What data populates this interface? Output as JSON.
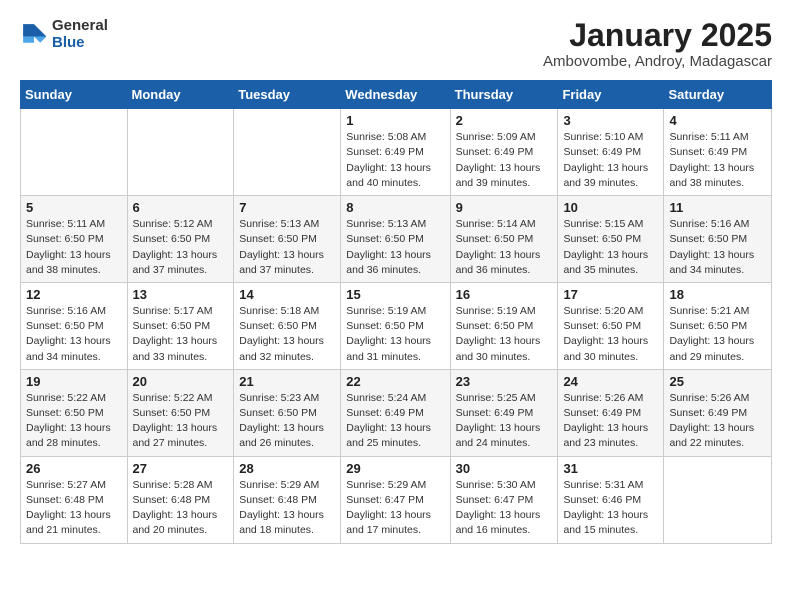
{
  "logo": {
    "general": "General",
    "blue": "Blue"
  },
  "header": {
    "title": "January 2025",
    "subtitle": "Ambovombe, Androy, Madagascar"
  },
  "weekdays": [
    "Sunday",
    "Monday",
    "Tuesday",
    "Wednesday",
    "Thursday",
    "Friday",
    "Saturday"
  ],
  "weeks": [
    [
      {
        "day": "",
        "detail": ""
      },
      {
        "day": "",
        "detail": ""
      },
      {
        "day": "",
        "detail": ""
      },
      {
        "day": "1",
        "detail": "Sunrise: 5:08 AM\nSunset: 6:49 PM\nDaylight: 13 hours\nand 40 minutes."
      },
      {
        "day": "2",
        "detail": "Sunrise: 5:09 AM\nSunset: 6:49 PM\nDaylight: 13 hours\nand 39 minutes."
      },
      {
        "day": "3",
        "detail": "Sunrise: 5:10 AM\nSunset: 6:49 PM\nDaylight: 13 hours\nand 39 minutes."
      },
      {
        "day": "4",
        "detail": "Sunrise: 5:11 AM\nSunset: 6:49 PM\nDaylight: 13 hours\nand 38 minutes."
      }
    ],
    [
      {
        "day": "5",
        "detail": "Sunrise: 5:11 AM\nSunset: 6:50 PM\nDaylight: 13 hours\nand 38 minutes."
      },
      {
        "day": "6",
        "detail": "Sunrise: 5:12 AM\nSunset: 6:50 PM\nDaylight: 13 hours\nand 37 minutes."
      },
      {
        "day": "7",
        "detail": "Sunrise: 5:13 AM\nSunset: 6:50 PM\nDaylight: 13 hours\nand 37 minutes."
      },
      {
        "day": "8",
        "detail": "Sunrise: 5:13 AM\nSunset: 6:50 PM\nDaylight: 13 hours\nand 36 minutes."
      },
      {
        "day": "9",
        "detail": "Sunrise: 5:14 AM\nSunset: 6:50 PM\nDaylight: 13 hours\nand 36 minutes."
      },
      {
        "day": "10",
        "detail": "Sunrise: 5:15 AM\nSunset: 6:50 PM\nDaylight: 13 hours\nand 35 minutes."
      },
      {
        "day": "11",
        "detail": "Sunrise: 5:16 AM\nSunset: 6:50 PM\nDaylight: 13 hours\nand 34 minutes."
      }
    ],
    [
      {
        "day": "12",
        "detail": "Sunrise: 5:16 AM\nSunset: 6:50 PM\nDaylight: 13 hours\nand 34 minutes."
      },
      {
        "day": "13",
        "detail": "Sunrise: 5:17 AM\nSunset: 6:50 PM\nDaylight: 13 hours\nand 33 minutes."
      },
      {
        "day": "14",
        "detail": "Sunrise: 5:18 AM\nSunset: 6:50 PM\nDaylight: 13 hours\nand 32 minutes."
      },
      {
        "day": "15",
        "detail": "Sunrise: 5:19 AM\nSunset: 6:50 PM\nDaylight: 13 hours\nand 31 minutes."
      },
      {
        "day": "16",
        "detail": "Sunrise: 5:19 AM\nSunset: 6:50 PM\nDaylight: 13 hours\nand 30 minutes."
      },
      {
        "day": "17",
        "detail": "Sunrise: 5:20 AM\nSunset: 6:50 PM\nDaylight: 13 hours\nand 30 minutes."
      },
      {
        "day": "18",
        "detail": "Sunrise: 5:21 AM\nSunset: 6:50 PM\nDaylight: 13 hours\nand 29 minutes."
      }
    ],
    [
      {
        "day": "19",
        "detail": "Sunrise: 5:22 AM\nSunset: 6:50 PM\nDaylight: 13 hours\nand 28 minutes."
      },
      {
        "day": "20",
        "detail": "Sunrise: 5:22 AM\nSunset: 6:50 PM\nDaylight: 13 hours\nand 27 minutes."
      },
      {
        "day": "21",
        "detail": "Sunrise: 5:23 AM\nSunset: 6:50 PM\nDaylight: 13 hours\nand 26 minutes."
      },
      {
        "day": "22",
        "detail": "Sunrise: 5:24 AM\nSunset: 6:49 PM\nDaylight: 13 hours\nand 25 minutes."
      },
      {
        "day": "23",
        "detail": "Sunrise: 5:25 AM\nSunset: 6:49 PM\nDaylight: 13 hours\nand 24 minutes."
      },
      {
        "day": "24",
        "detail": "Sunrise: 5:26 AM\nSunset: 6:49 PM\nDaylight: 13 hours\nand 23 minutes."
      },
      {
        "day": "25",
        "detail": "Sunrise: 5:26 AM\nSunset: 6:49 PM\nDaylight: 13 hours\nand 22 minutes."
      }
    ],
    [
      {
        "day": "26",
        "detail": "Sunrise: 5:27 AM\nSunset: 6:48 PM\nDaylight: 13 hours\nand 21 minutes."
      },
      {
        "day": "27",
        "detail": "Sunrise: 5:28 AM\nSunset: 6:48 PM\nDaylight: 13 hours\nand 20 minutes."
      },
      {
        "day": "28",
        "detail": "Sunrise: 5:29 AM\nSunset: 6:48 PM\nDaylight: 13 hours\nand 18 minutes."
      },
      {
        "day": "29",
        "detail": "Sunrise: 5:29 AM\nSunset: 6:47 PM\nDaylight: 13 hours\nand 17 minutes."
      },
      {
        "day": "30",
        "detail": "Sunrise: 5:30 AM\nSunset: 6:47 PM\nDaylight: 13 hours\nand 16 minutes."
      },
      {
        "day": "31",
        "detail": "Sunrise: 5:31 AM\nSunset: 6:46 PM\nDaylight: 13 hours\nand 15 minutes."
      },
      {
        "day": "",
        "detail": ""
      }
    ]
  ]
}
